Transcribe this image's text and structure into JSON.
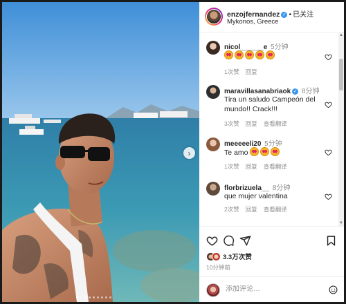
{
  "post": {
    "username": "enzojfernandez",
    "separator": "•",
    "follow_label": "已关注",
    "location": "Mykonos, Greece"
  },
  "comments": [
    {
      "user": "nicol______e",
      "time": "5分钟",
      "text": "",
      "emoji_count": 5,
      "likes": "1次赞",
      "reply": "回复",
      "translate": ""
    },
    {
      "user": "maravillasanabriaok",
      "verified": true,
      "time": "8分钟",
      "text": "Tira un saludo Campeón del mundo!! Crack!!!",
      "emoji_count": 0,
      "likes": "3次赞",
      "reply": "回复",
      "translate": "查看翻译"
    },
    {
      "user": "meeeeeli20",
      "time": "5分钟",
      "text": "Te amo",
      "emoji_count": 3,
      "likes": "1次赞",
      "reply": "回复",
      "translate": "查看翻译"
    },
    {
      "user": "florbrizuela__",
      "time": "8分钟",
      "text": "que mujer valentina",
      "emoji_count": 0,
      "likes": "2次赞",
      "reply": "回复",
      "translate": "查看翻译"
    }
  ],
  "actions": {
    "like_icon": "heart-icon",
    "comment_icon": "comment-icon",
    "share_icon": "share-icon",
    "save_icon": "bookmark-icon"
  },
  "likes_count": "3.3万次赞",
  "post_time": "10分钟前",
  "add_comment": {
    "placeholder": "添加评论…"
  },
  "carousel": {
    "slides": 9,
    "active_index": 0
  },
  "colors": {
    "verified": "#3897f0",
    "muted": "#8e8e8e",
    "text": "#262626"
  }
}
